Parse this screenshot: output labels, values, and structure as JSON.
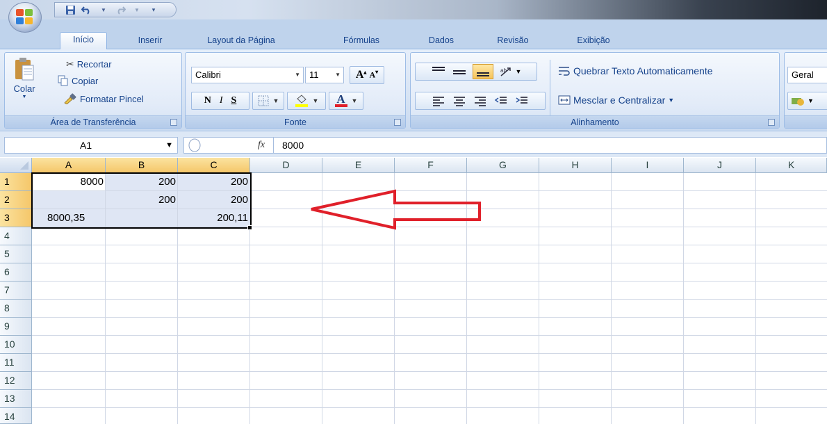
{
  "qat": {
    "save": "save-icon",
    "undo": "undo-icon",
    "redo": "redo-icon"
  },
  "tabs": [
    "Início",
    "Inserir",
    "Layout da Página",
    "Fórmulas",
    "Dados",
    "Revisão",
    "Exibição"
  ],
  "clipboard": {
    "paste": "Colar",
    "cut": "Recortar",
    "copy": "Copiar",
    "format_painter": "Formatar Pincel",
    "label": "Área de Transferência"
  },
  "font": {
    "name": "Calibri",
    "size": "11",
    "grow": "A",
    "shrink": "A",
    "bold": "N",
    "italic": "I",
    "underline": "S",
    "color_letter": "A",
    "label": "Fonte"
  },
  "alignment": {
    "wrap": "Quebrar Texto Automaticamente",
    "merge": "Mesclar e Centralizar",
    "label": "Alinhamento"
  },
  "number": {
    "format": "Geral"
  },
  "formula_bar": {
    "name_box": "A1",
    "fx": "fx",
    "value": "8000"
  },
  "columns": [
    "A",
    "B",
    "C",
    "D",
    "E",
    "F",
    "G",
    "H",
    "I",
    "J",
    "K"
  ],
  "rows": [
    "1",
    "2",
    "3",
    "4",
    "5",
    "6",
    "7",
    "8",
    "9",
    "10",
    "11",
    "12",
    "13",
    "14"
  ],
  "cells": {
    "A1": "8000",
    "B1": "200",
    "C1": "200",
    "B2": "200",
    "C2": "200",
    "A3": "8000,35",
    "C3": "200,11"
  },
  "colors": {
    "selection_header": "#f5c76a",
    "arrow": "#e0202a"
  }
}
